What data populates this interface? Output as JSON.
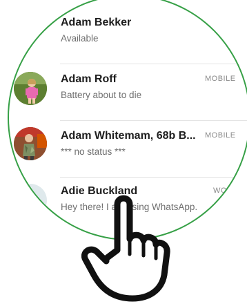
{
  "contacts": [
    {
      "name": "Adam Bekker",
      "status": "Available",
      "type": ""
    },
    {
      "name": "Adam Roff",
      "status": "Battery about to die",
      "type": "MOBILE"
    },
    {
      "name": "Adam Whitemam, 68b B...",
      "status": "*** no status ***",
      "type": "MOBILE"
    },
    {
      "name": "Adie Buckland",
      "status": "Hey there! I am using WhatsApp.",
      "type": "WORK"
    }
  ],
  "colors": {
    "frame_green": "#36a046",
    "tab_green": "#2f9a3a",
    "text_primary": "#1d1d1d",
    "text_secondary": "#6e6e6e"
  },
  "icons": [
    "pointing-hand-icon"
  ]
}
